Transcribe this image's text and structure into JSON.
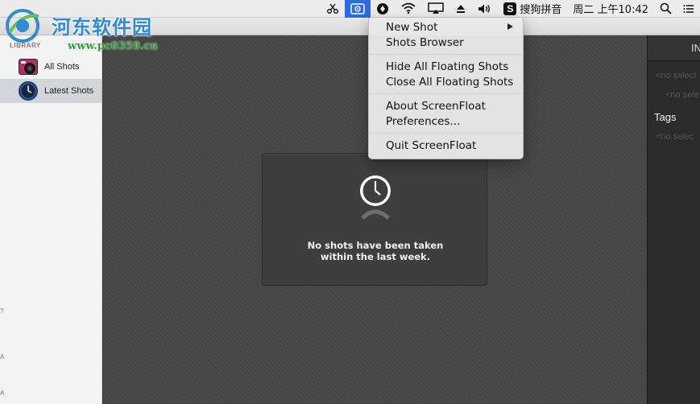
{
  "watermark": {
    "site_name": "河东软件园",
    "url": "www.pc0359.cn",
    "colors": {
      "name": "#2f8bd6",
      "url": "#2fa23d"
    }
  },
  "menubar": {
    "input_method": "搜狗拼音",
    "input_method_badge": "S",
    "clock": "周二 上午10:42",
    "icons": [
      "scissors-icon",
      "screenfloat-icon",
      "vpn-shield-icon",
      "wifi-icon",
      "airplay-icon",
      "eject-icon",
      "volume-icon",
      "search-icon",
      "notification-center-icon"
    ],
    "accent_color": "#2b6ce3"
  },
  "sidebar": {
    "header": "LIBRARY",
    "items": [
      {
        "label": "All Shots",
        "icon": "camera-icon",
        "selected": false
      },
      {
        "label": "Latest Shots",
        "icon": "clock-icon",
        "selected": true
      }
    ]
  },
  "main": {
    "empty_state": {
      "icon": "clock-icon",
      "line1": "No shots have been taken",
      "line2": "within the last week."
    }
  },
  "inspector": {
    "header": "IN",
    "field1": "<no select",
    "field2": "<no sele",
    "tags_label": "Tags",
    "field3": "<no selec"
  },
  "menu": {
    "items_group1": [
      "New Shot",
      "Shots Browser"
    ],
    "items_group2": [
      "Hide All Floating Shots",
      "Close All Floating Shots"
    ],
    "items_group3": [
      "About ScreenFloat",
      "Preferences..."
    ],
    "items_group4": [
      "Quit ScreenFloat"
    ],
    "submenu_item": "New Shot"
  },
  "edge_marks": [
    "?",
    "A",
    "A"
  ]
}
